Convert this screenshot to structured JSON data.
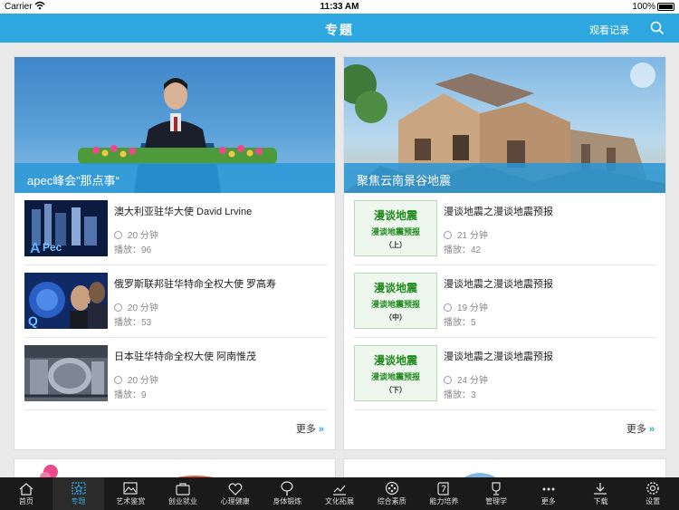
{
  "status_bar": {
    "carrier": "Carrier",
    "time": "11:33 AM",
    "battery": "100%"
  },
  "nav": {
    "title": "专题",
    "history": "观看记录",
    "search_icon": "search-icon"
  },
  "cards": [
    {
      "caption": "apec峰会”那点事“",
      "items": [
        {
          "title": "澳大利亚驻华大使 David Lrvine",
          "duration": "20 分钟",
          "plays": "播放：96"
        },
        {
          "title": "俄罗斯联邦驻华特命全权大使 罗高寿",
          "duration": "20 分钟",
          "plays": "播放：53"
        },
        {
          "title": "日本驻华特命全权大使 阿南惟茂",
          "duration": "20 分钟",
          "plays": "播放：9"
        }
      ],
      "more": "更多"
    },
    {
      "caption": "聚焦云南景谷地震",
      "items": [
        {
          "title": "漫谈地震之漫谈地震预报",
          "duration": "21 分钟",
          "plays": "播放：42",
          "thumb": [
            "漫谈地震",
            "漫谈地震预报",
            "（上）"
          ]
        },
        {
          "title": "漫谈地震之漫谈地震预报",
          "duration": "19 分钟",
          "plays": "播放：5",
          "thumb": [
            "漫谈地震",
            "漫谈地震预报",
            "（中）"
          ]
        },
        {
          "title": "漫谈地震之漫谈地震预报",
          "duration": "24 分钟",
          "plays": "播放：3",
          "thumb": [
            "漫谈地震",
            "漫谈地震预报",
            "（下）"
          ]
        }
      ],
      "more": "更多"
    }
  ],
  "tabs": [
    {
      "label": "首页",
      "icon": "home-icon"
    },
    {
      "label": "专题",
      "icon": "topic-star-icon",
      "active": true
    },
    {
      "label": "艺术鉴赏",
      "icon": "picture-icon"
    },
    {
      "label": "创业就业",
      "icon": "briefcase-icon"
    },
    {
      "label": "心理健康",
      "icon": "heart-icon"
    },
    {
      "label": "身体锻炼",
      "icon": "racket-icon"
    },
    {
      "label": "文化拓展",
      "icon": "chart-icon"
    },
    {
      "label": "综合素质",
      "icon": "film-reel-icon"
    },
    {
      "label": "能力培养",
      "icon": "book-icon"
    },
    {
      "label": "管理学",
      "icon": "trophy-icon"
    },
    {
      "label": "更多",
      "icon": "more-dots-icon"
    },
    {
      "label": "下载",
      "icon": "download-icon"
    },
    {
      "label": "设置",
      "icon": "gear-icon"
    }
  ]
}
